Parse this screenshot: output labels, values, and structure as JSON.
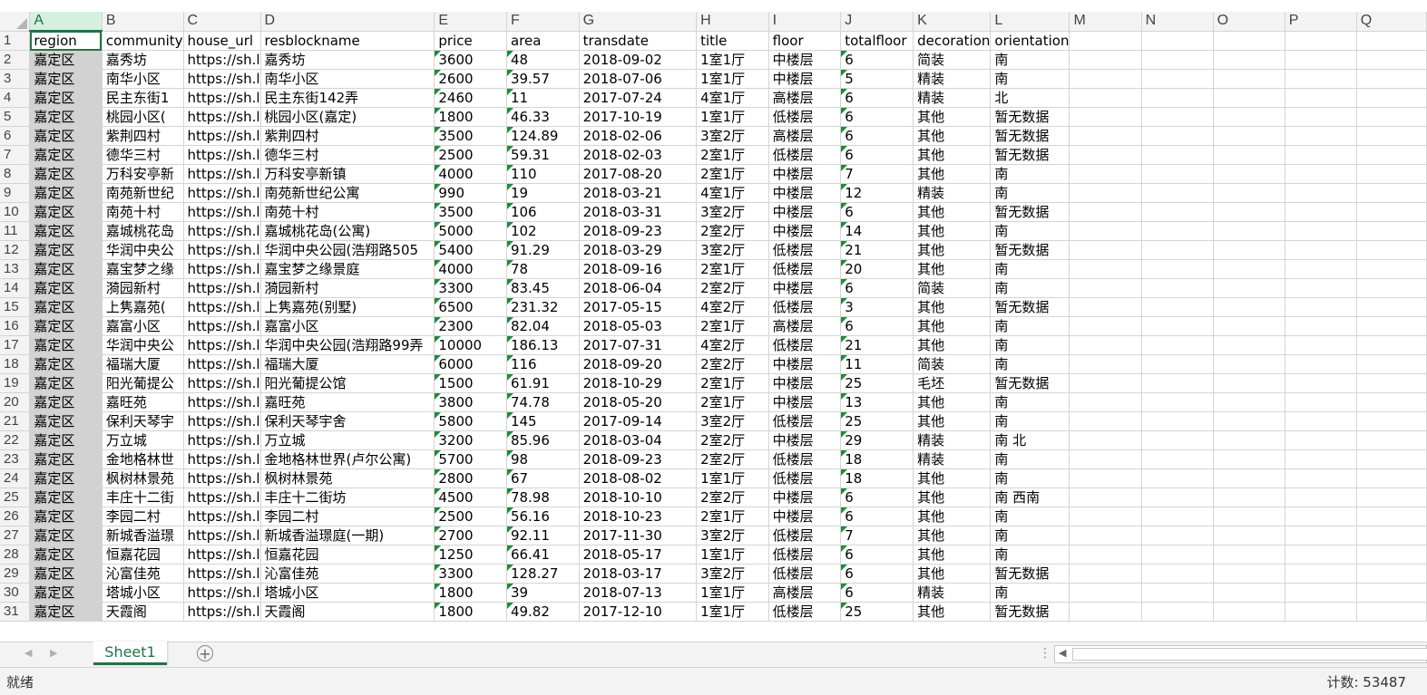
{
  "columns": [
    "A",
    "B",
    "C",
    "D",
    "E",
    "F",
    "G",
    "H",
    "I",
    "J",
    "K",
    "L",
    "M",
    "N",
    "O",
    "P",
    "Q"
  ],
  "headers": [
    "region",
    "community",
    "house_url",
    "resblockname",
    "price",
    "area",
    "transdate",
    "title",
    "floor",
    "totalfloor",
    "decoration",
    "orientation"
  ],
  "rows": [
    [
      "嘉定区",
      "嘉秀坊",
      "https://sh.l",
      "嘉秀坊",
      "3600",
      "48",
      "2018-09-02",
      "1室1厅",
      "中楼层",
      "6",
      "简装",
      "南"
    ],
    [
      "嘉定区",
      "南华小区",
      "https://sh.l",
      "南华小区",
      "2600",
      "39.57",
      "2018-07-06",
      "1室1厅",
      "中楼层",
      "5",
      "精装",
      "南"
    ],
    [
      "嘉定区",
      "民主东街1",
      "https://sh.l",
      "民主东街142弄",
      "2460",
      "11",
      "2017-07-24",
      "4室1厅",
      "高楼层",
      "6",
      "精装",
      "北"
    ],
    [
      "嘉定区",
      "桃园小区(",
      "https://sh.l",
      "桃园小区(嘉定)",
      "1800",
      "46.33",
      "2017-10-19",
      "1室1厅",
      "低楼层",
      "6",
      "其他",
      "暂无数据"
    ],
    [
      "嘉定区",
      "紫荆四村",
      "https://sh.l",
      "紫荆四村",
      "3500",
      "124.89",
      "2018-02-06",
      "3室2厅",
      "高楼层",
      "6",
      "其他",
      "暂无数据"
    ],
    [
      "嘉定区",
      "德华三村",
      "https://sh.l",
      "德华三村",
      "2500",
      "59.31",
      "2018-02-03",
      "2室1厅",
      "低楼层",
      "6",
      "其他",
      "暂无数据"
    ],
    [
      "嘉定区",
      "万科安亭新",
      "https://sh.l",
      "万科安亭新镇",
      "4000",
      "110",
      "2017-08-20",
      "2室1厅",
      "中楼层",
      "7",
      "其他",
      "南"
    ],
    [
      "嘉定区",
      "南苑新世纪",
      "https://sh.l",
      "南苑新世纪公寓",
      "990",
      "19",
      "2018-03-21",
      "4室1厅",
      "中楼层",
      "12",
      "精装",
      "南"
    ],
    [
      "嘉定区",
      "南苑十村",
      "https://sh.l",
      "南苑十村",
      "3500",
      "106",
      "2018-03-31",
      "3室2厅",
      "中楼层",
      "6",
      "其他",
      "暂无数据"
    ],
    [
      "嘉定区",
      "嘉城桃花岛",
      "https://sh.l",
      "嘉城桃花岛(公寓)",
      "5000",
      "102",
      "2018-09-23",
      "2室2厅",
      "中楼层",
      "14",
      "其他",
      "南"
    ],
    [
      "嘉定区",
      "华润中央公",
      "https://sh.l",
      "华润中央公园(浩翔路505",
      "5400",
      "91.29",
      "2018-03-29",
      "3室2厅",
      "低楼层",
      "21",
      "其他",
      "暂无数据"
    ],
    [
      "嘉定区",
      "嘉宝梦之缘",
      "https://sh.l",
      "嘉宝梦之缘景庭",
      "4000",
      "78",
      "2018-09-16",
      "2室1厅",
      "低楼层",
      "20",
      "其他",
      "南"
    ],
    [
      "嘉定区",
      "漪园新村",
      "https://sh.l",
      "漪园新村",
      "3300",
      "83.45",
      "2018-06-04",
      "2室2厅",
      "中楼层",
      "6",
      "简装",
      "南"
    ],
    [
      "嘉定区",
      "上隽嘉苑(",
      "https://sh.l",
      "上隽嘉苑(别墅)",
      "6500",
      "231.32",
      "2017-05-15",
      "4室2厅",
      "低楼层",
      "3",
      "其他",
      "暂无数据"
    ],
    [
      "嘉定区",
      "嘉富小区",
      "https://sh.l",
      "嘉富小区",
      "2300",
      "82.04",
      "2018-05-03",
      "2室1厅",
      "高楼层",
      "6",
      "其他",
      "南"
    ],
    [
      "嘉定区",
      "华润中央公",
      "https://sh.l",
      "华润中央公园(浩翔路99弄",
      "10000",
      "186.13",
      "2017-07-31",
      "4室2厅",
      "低楼层",
      "21",
      "其他",
      "南"
    ],
    [
      "嘉定区",
      "福瑞大厦",
      "https://sh.l",
      "福瑞大厦",
      "6000",
      "116",
      "2018-09-20",
      "2室2厅",
      "中楼层",
      "11",
      "简装",
      "南"
    ],
    [
      "嘉定区",
      "阳光葡提公",
      "https://sh.l",
      "阳光葡提公馆",
      "1500",
      "61.91",
      "2018-10-29",
      "2室1厅",
      "中楼层",
      "25",
      "毛坯",
      "暂无数据"
    ],
    [
      "嘉定区",
      "嘉旺苑",
      "https://sh.l",
      "嘉旺苑",
      "3800",
      "74.78",
      "2018-05-20",
      "2室1厅",
      "中楼层",
      "13",
      "其他",
      "南"
    ],
    [
      "嘉定区",
      "保利天琴宇",
      "https://sh.l",
      "保利天琴宇舍",
      "5800",
      "145",
      "2017-09-14",
      "3室2厅",
      "低楼层",
      "25",
      "其他",
      "南"
    ],
    [
      "嘉定区",
      "万立城",
      "https://sh.l",
      "万立城",
      "3200",
      "85.96",
      "2018-03-04",
      "2室2厅",
      "中楼层",
      "29",
      "精装",
      "南 北"
    ],
    [
      "嘉定区",
      "金地格林世",
      "https://sh.l",
      "金地格林世界(卢尔公寓)",
      "5700",
      "98",
      "2018-09-23",
      "2室2厅",
      "低楼层",
      "18",
      "精装",
      "南"
    ],
    [
      "嘉定区",
      "枫树林景苑",
      "https://sh.l",
      "枫树林景苑",
      "2800",
      "67",
      "2018-08-02",
      "1室1厅",
      "低楼层",
      "18",
      "其他",
      "南"
    ],
    [
      "嘉定区",
      "丰庄十二街",
      "https://sh.l",
      "丰庄十二街坊",
      "4500",
      "78.98",
      "2018-10-10",
      "2室2厅",
      "中楼层",
      "6",
      "其他",
      "南 西南"
    ],
    [
      "嘉定区",
      "李园二村",
      "https://sh.l",
      "李园二村",
      "2500",
      "56.16",
      "2018-10-23",
      "2室1厅",
      "中楼层",
      "6",
      "其他",
      "南"
    ],
    [
      "嘉定区",
      "新城香溢璟",
      "https://sh.l",
      "新城香溢璟庭(一期)",
      "2700",
      "92.11",
      "2017-11-30",
      "3室2厅",
      "低楼层",
      "7",
      "其他",
      "南"
    ],
    [
      "嘉定区",
      "恒嘉花园",
      "https://sh.l",
      "恒嘉花园",
      "1250",
      "66.41",
      "2018-05-17",
      "1室1厅",
      "低楼层",
      "6",
      "其他",
      "南"
    ],
    [
      "嘉定区",
      "沁富佳苑",
      "https://sh.l",
      "沁富佳苑",
      "3300",
      "128.27",
      "2018-03-17",
      "3室2厅",
      "低楼层",
      "6",
      "其他",
      "暂无数据"
    ],
    [
      "嘉定区",
      "塔城小区",
      "https://sh.l",
      "塔城小区",
      "1800",
      "39",
      "2018-07-13",
      "1室1厅",
      "高楼层",
      "6",
      "精装",
      "南"
    ],
    [
      "嘉定区",
      "天霞阁",
      "https://sh.l",
      "天霞阁",
      "1800",
      "49.82",
      "2017-12-10",
      "1室1厅",
      "低楼层",
      "25",
      "其他",
      "暂无数据"
    ]
  ],
  "sheet_tab": "Sheet1",
  "add_sheet_symbol": "+",
  "status": {
    "ready": "就绪",
    "count": "计数: 53487"
  },
  "colors": {
    "accent": "#217346",
    "number_flag": "#1f8b3c",
    "selected_column": "#d2d2d2"
  }
}
